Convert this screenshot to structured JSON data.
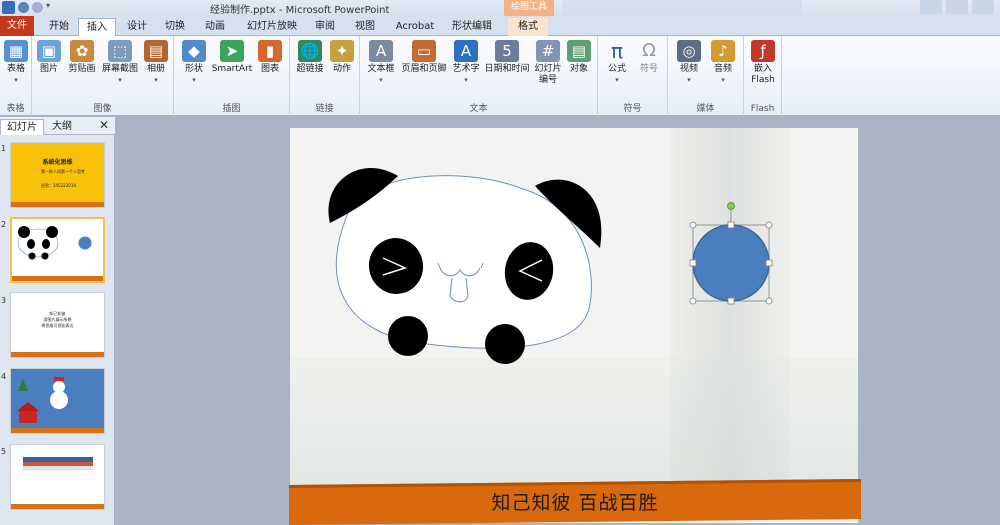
{
  "window": {
    "title": "经验制作.pptx  -  Microsoft PowerPoint",
    "contextual_tools": "绘图工具"
  },
  "tabs": [
    "文件",
    "开始",
    "插入",
    "设计",
    "切换",
    "动画",
    "幻灯片放映",
    "审阅",
    "视图",
    "Acrobat",
    "形状编辑",
    "格式"
  ],
  "active_tab": "插入",
  "ribbon": {
    "groups": {
      "tables": "表格",
      "images": "图像",
      "illustrations": "插图",
      "links": "链接",
      "text": "文本",
      "symbols": "符号",
      "media": "媒体",
      "flash": "Flash"
    },
    "buttons": {
      "table": "表格",
      "picture": "图片",
      "clipart": "剪贴画",
      "screenshot": "屏幕截图",
      "album": "相册",
      "shapes": "形状",
      "smartart": "SmartArt",
      "chart": "图表",
      "hyperlink": "超链接",
      "action": "动作",
      "textbox": "文本框",
      "header_footer": "页眉和页脚",
      "wordart": "艺术字",
      "datetime": "日期和时间",
      "slide_number": "幻灯片\n编号",
      "object": "对象",
      "equation": "公式",
      "symbol": "符号",
      "video": "视频",
      "audio": "音频",
      "embed_flash": "嵌入\nFlash"
    }
  },
  "panel": {
    "tabs": [
      "幻灯片",
      "大纲"
    ],
    "close": "✕",
    "slide_numbers": [
      "1",
      "2",
      "3",
      "4",
      "5"
    ],
    "thumb1_title": "系统化思维",
    "thumb1_sub": "第一阶人间第一个人思考",
    "thumb1_note": "经验：145222014",
    "thumb3_lines": [
      "知己知彼",
      "用图片展示所想",
      "将思维可视化表达"
    ]
  },
  "slide": {
    "footer_text": "知己知彼  百战百胜",
    "colors": {
      "banner": "#d8690c",
      "circle_fill": "#4a7ebf",
      "circle_stroke": "#3a6699",
      "panda_black": "#000000",
      "outline": "#6a8dc4"
    }
  },
  "icons": [
    "save-icon",
    "undo-icon",
    "redo-icon",
    "table-icon",
    "picture-icon",
    "clipart-icon",
    "screenshot-icon",
    "album-icon",
    "shapes-icon",
    "smartart-icon",
    "chart-icon",
    "hyperlink-icon",
    "action-icon",
    "textbox-icon",
    "header-footer-icon",
    "wordart-icon",
    "datetime-icon",
    "slide-number-icon",
    "object-icon",
    "equation-icon",
    "symbol-icon",
    "video-icon",
    "audio-icon",
    "flash-icon"
  ]
}
